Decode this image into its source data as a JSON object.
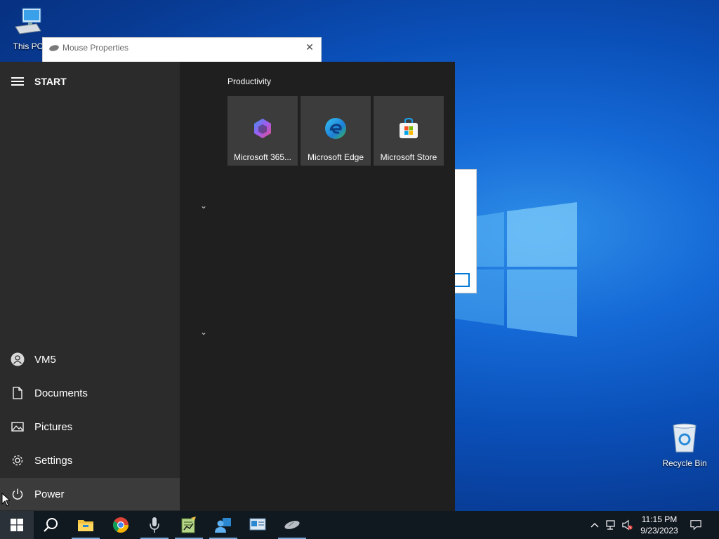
{
  "desktop": {
    "icons": [
      {
        "label": "This PC",
        "icon": "computer-icon"
      },
      {
        "label": "Recycle Bin",
        "icon": "recycle-bin-icon"
      }
    ]
  },
  "background_window": {
    "title": "Mouse Properties",
    "close_glyph": "✕",
    "icon": "mouse-icon"
  },
  "start_menu": {
    "header": "START",
    "user": "VM5",
    "nav": [
      {
        "label": "Documents",
        "icon": "document-icon"
      },
      {
        "label": "Pictures",
        "icon": "pictures-icon"
      },
      {
        "label": "Settings",
        "icon": "gear-icon"
      },
      {
        "label": "Power",
        "icon": "power-icon"
      }
    ],
    "group_title": "Productivity",
    "tiles": [
      {
        "label": "Microsoft 365...",
        "icon": "microsoft-365-icon"
      },
      {
        "label": "Microsoft Edge",
        "icon": "edge-icon"
      },
      {
        "label": "Microsoft Store",
        "icon": "store-icon"
      }
    ]
  },
  "taskbar": {
    "pinned": [
      "start-icon",
      "search-icon",
      "file-explorer-icon",
      "chrome-icon",
      "microphone-icon",
      "notepad-chart-icon",
      "people-icon",
      "control-panel-icon",
      "mouse-icon"
    ],
    "clock": {
      "time": "11:15 PM",
      "date": "9/23/2023"
    },
    "tray": [
      "chevron-up-icon",
      "network-icon",
      "volume-muted-icon",
      "notification-icon"
    ]
  },
  "colors": {
    "accent": "#0078d7",
    "start_bg": "#1f1f1f",
    "start_left_bg": "#2b2b2b",
    "tile_bg": "#3c3c3c",
    "taskbar_bg": "#101820"
  }
}
